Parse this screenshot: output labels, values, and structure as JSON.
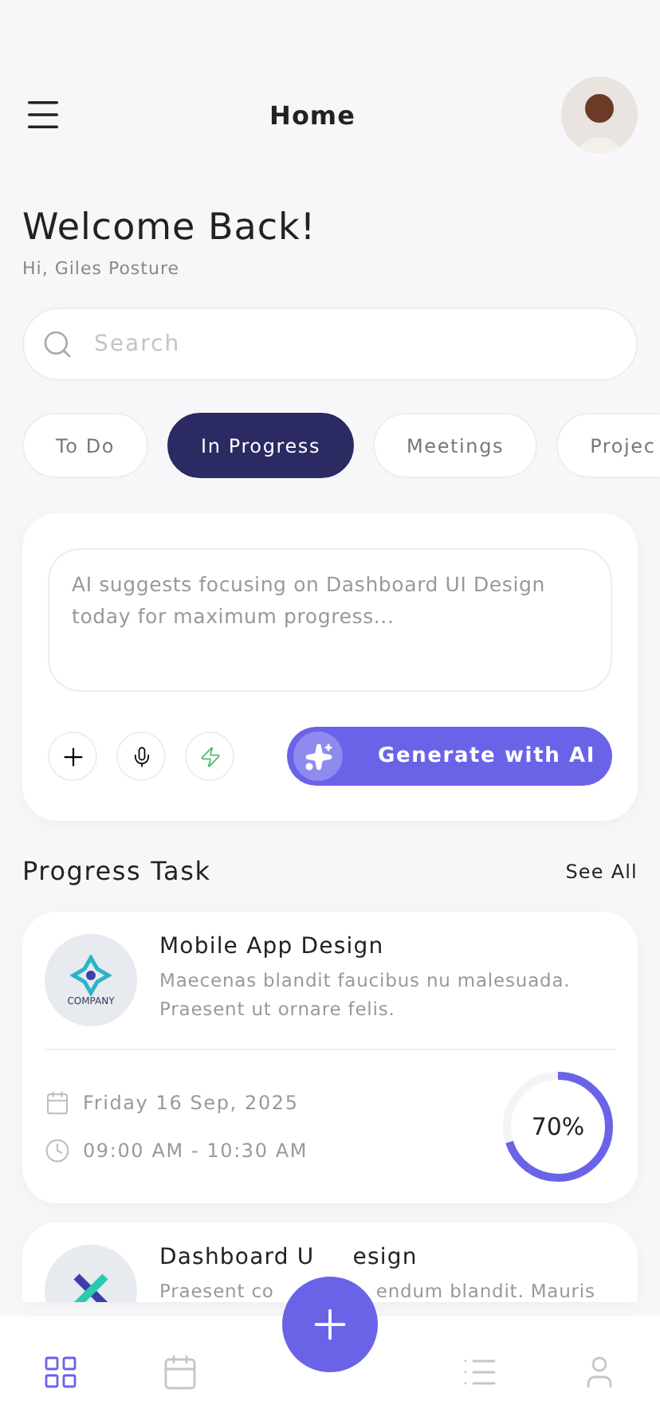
{
  "header": {
    "title": "Home"
  },
  "welcome": {
    "title": "Welcome Back!",
    "subtitle": "Hi, Giles Posture"
  },
  "search": {
    "placeholder": "Search"
  },
  "tabs": [
    {
      "label": "To Do",
      "selected": false
    },
    {
      "label": "In Progress",
      "selected": true
    },
    {
      "label": "Meetings",
      "selected": false
    },
    {
      "label": "Projec",
      "selected": false
    }
  ],
  "ai_card": {
    "placeholder": "AI suggests focusing on Dashboard UI Design today for maximum progress...",
    "button": "Generate with AI"
  },
  "section": {
    "title": "Progress Task",
    "link": "See All"
  },
  "tasks": [
    {
      "kind": "full",
      "logo_text": "COMPANY",
      "title_parts": [
        "Mobile App Design"
      ],
      "description_parts": [
        "Maecenas blandit faucibus nu malesuada. Praesent ut ornare felis."
      ],
      "date": "Friday 16 Sep, 2025",
      "time": "09:00 AM - 10:30 AM",
      "percent": "70%"
    },
    {
      "kind": "covered",
      "title_parts": [
        "Dashboard U",
        "esign"
      ],
      "description_parts": [
        "Praesent co",
        "endum blandit. Mauris"
      ]
    }
  ],
  "nav": [
    {
      "kind": "grid",
      "selected": true
    },
    {
      "kind": "calendar",
      "selected": false
    },
    {
      "kind": "add"
    },
    {
      "kind": "list",
      "selected": false
    },
    {
      "kind": "user",
      "selected": false
    }
  ]
}
